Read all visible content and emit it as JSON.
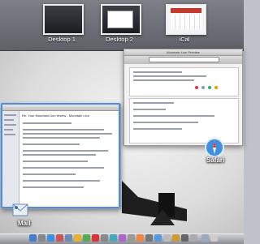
{
  "spaces": [
    {
      "label": "Desktop 1"
    },
    {
      "label": "Desktop 2"
    },
    {
      "label": "iCal"
    }
  ],
  "windows": {
    "mail": {
      "app_label": "Mail",
      "subject": "Re: Your Mountain Lion review - Mountain Lion"
    },
    "safari": {
      "app_label": "Safari",
      "title": "Mountain Lion Preview"
    }
  },
  "colors": {
    "selection": "#4c8fe0"
  }
}
